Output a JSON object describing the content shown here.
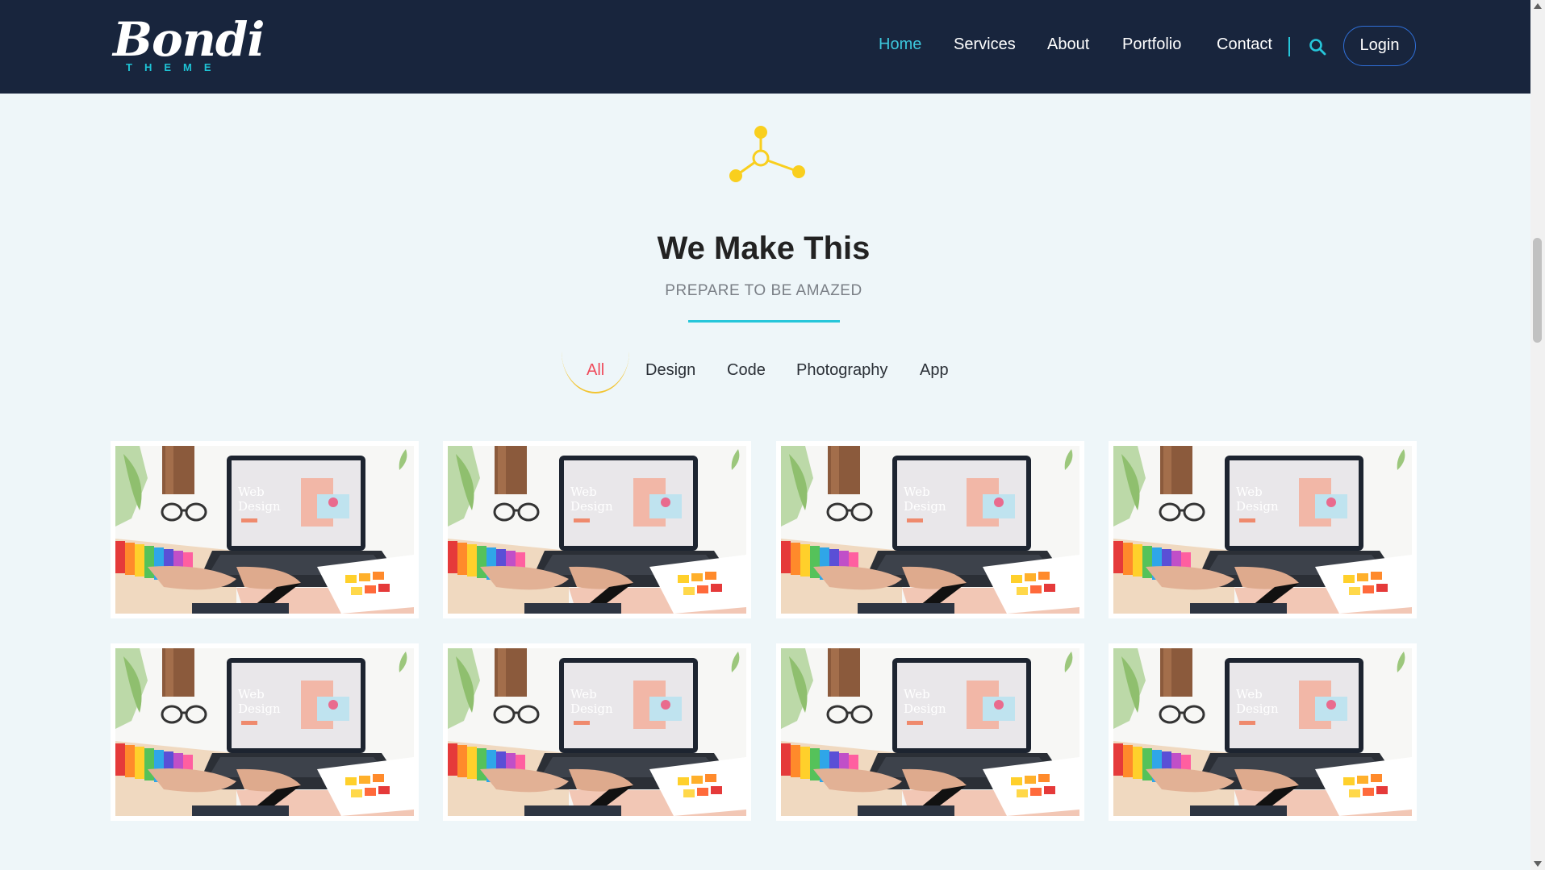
{
  "brand": {
    "name": "Bondi",
    "tagline": "THEME"
  },
  "nav": {
    "items": [
      {
        "label": "Home",
        "active": true
      },
      {
        "label": "Services",
        "active": false
      },
      {
        "label": "About",
        "active": false
      },
      {
        "label": "Portfolio",
        "active": false
      },
      {
        "label": "Contact",
        "active": false
      }
    ],
    "login_label": "Login"
  },
  "section": {
    "title": "We Make This",
    "subtitle": "PREPARE TO BE AMAZED"
  },
  "filters": [
    {
      "label": "All",
      "active": true
    },
    {
      "label": "Design",
      "active": false
    },
    {
      "label": "Code",
      "active": false
    },
    {
      "label": "Photography",
      "active": false
    },
    {
      "label": "App",
      "active": false
    }
  ],
  "portfolio": {
    "items": [
      {
        "image_text": "Web Design"
      },
      {
        "image_text": "Web Design"
      },
      {
        "image_text": "Web Design"
      },
      {
        "image_text": "Web Design"
      },
      {
        "image_text": "Web Design"
      },
      {
        "image_text": "Web Design"
      },
      {
        "image_text": "Web Design"
      },
      {
        "image_text": "Web Design"
      }
    ]
  },
  "colors": {
    "navbar": "#18253d",
    "accent_cyan": "#26c6da",
    "accent_yellow": "#f2c431",
    "active_filter": "#ef4a5a",
    "login_border": "#2f6fd8",
    "background": "#eef6f9"
  },
  "icons": {
    "search": "search-icon",
    "network": "share-network-icon"
  }
}
